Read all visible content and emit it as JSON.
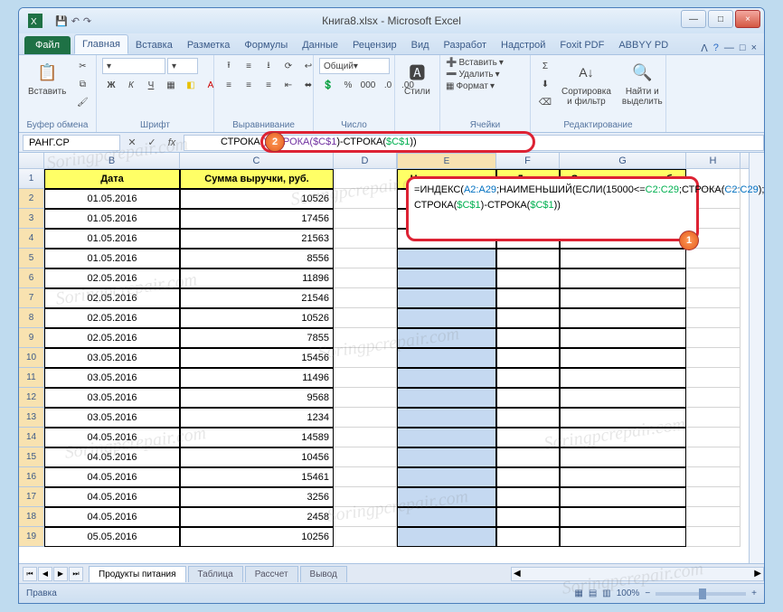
{
  "window": {
    "title": "Книга8.xlsx - Microsoft Excel",
    "minimize": "—",
    "maximize": "□",
    "close": "×"
  },
  "qat": {
    "save": "💾",
    "undo": "↶",
    "redo": "↷"
  },
  "tabs": {
    "file": "Файл",
    "items": [
      "Главная",
      "Вставка",
      "Разметка",
      "Формулы",
      "Данные",
      "Рецензир",
      "Вид",
      "Разработ",
      "Надстрой",
      "Foxit PDF",
      "ABBYY PD"
    ],
    "active": 0
  },
  "ribbon": {
    "clipboard": {
      "label": "Буфер обмена",
      "paste": "Вставить"
    },
    "font": {
      "label": "Шрифт"
    },
    "alignment": {
      "label": "Выравнивание"
    },
    "number": {
      "label": "Число",
      "format": "Общий"
    },
    "styles": {
      "label": "Стили",
      "btn": "Стили"
    },
    "cells": {
      "label": "Ячейки",
      "insert": "Вставить",
      "delete": "Удалить",
      "format": "Формат"
    },
    "editing": {
      "label": "Редактирование",
      "sort": "Сортировка и фильтр",
      "find": "Найти и выделить"
    }
  },
  "namebox": "РАНГ.СР",
  "formula_bar": {
    "cancel": "✕",
    "enter": "✓",
    "fx": "fx",
    "visible_fragment_pre": "СТРОКА",
    "visible_fragment_mid": "()-СТРОКА(",
    "visible_fragment_ref1": "$C$1",
    "visible_fragment_mid2": ")-СТРОКА(",
    "visible_fragment_ref2": "$C$1",
    "visible_fragment_end": "))"
  },
  "callout_badges": {
    "one": "1",
    "two": "2"
  },
  "columns": [
    "B",
    "C",
    "D",
    "E",
    "F",
    "G",
    "H"
  ],
  "headers": {
    "B": "Дата",
    "C": "Сумма выручки, руб.",
    "E": "Наименование",
    "F": "Дата",
    "G": "Сумма выручки, руб."
  },
  "rows": [
    {
      "n": 1
    },
    {
      "n": 2,
      "B": "01.05.2016",
      "C": "10526"
    },
    {
      "n": 3,
      "B": "01.05.2016",
      "C": "17456"
    },
    {
      "n": 4,
      "B": "01.05.2016",
      "C": "21563"
    },
    {
      "n": 5,
      "B": "01.05.2016",
      "C": "8556"
    },
    {
      "n": 6,
      "B": "02.05.2016",
      "C": "11896"
    },
    {
      "n": 7,
      "B": "02.05.2016",
      "C": "21546"
    },
    {
      "n": 8,
      "B": "02.05.2016",
      "C": "10526"
    },
    {
      "n": 9,
      "B": "02.05.2016",
      "C": "7855"
    },
    {
      "n": 10,
      "B": "03.05.2016",
      "C": "15456"
    },
    {
      "n": 11,
      "B": "03.05.2016",
      "C": "11496"
    },
    {
      "n": 12,
      "B": "03.05.2016",
      "C": "9568"
    },
    {
      "n": 13,
      "B": "03.05.2016",
      "C": "1234"
    },
    {
      "n": 14,
      "B": "04.05.2016",
      "C": "14589"
    },
    {
      "n": 15,
      "B": "04.05.2016",
      "C": "10456"
    },
    {
      "n": 16,
      "B": "04.05.2016",
      "C": "15461"
    },
    {
      "n": 17,
      "B": "04.05.2016",
      "C": "3256"
    },
    {
      "n": 18,
      "B": "04.05.2016",
      "C": "2458"
    },
    {
      "n": 19,
      "B": "05.05.2016",
      "C": "10256"
    }
  ],
  "formula_overlay": {
    "eq": "=",
    "p1": "ИНДЕКС(",
    "r1": "A2:A29",
    "p2": ";НАИМЕНЬШИЙ(ЕСЛИ(15000<=",
    "r2": "C2:C29",
    "p3": ";СТРОКА(",
    "r3": "C2:C29",
    "p4": ");\"\");СТРОКА",
    "p5": "()",
    "p6": "-СТРОКА(",
    "r4": "$C$1",
    "p7": ")-СТРОКА(",
    "r5": "$C$1",
    "p8": "))"
  },
  "sheets": {
    "active": "Продукты питания",
    "others": [
      "Таблица",
      "Рассчет",
      "Вывод"
    ]
  },
  "statusbar": {
    "mode": "Правка",
    "zoom": "100%",
    "minus": "−",
    "plus": "+"
  },
  "watermark": "Soringpcrepair.com"
}
